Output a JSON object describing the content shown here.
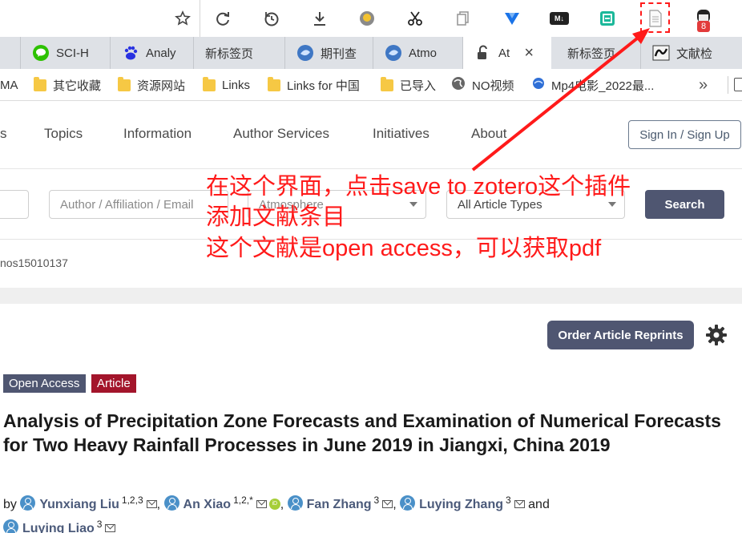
{
  "toolbar": {
    "icons": [
      "star-icon",
      "reload-icon",
      "history-icon",
      "download-icon",
      "extension-icon",
      "scissors-icon",
      "copy-icon",
      "extension-icon",
      "markdown-icon",
      "qr-icon",
      "zotero-save-icon",
      "profile-icon"
    ],
    "markdown_label": "M↓",
    "badge_count": "8"
  },
  "tabs": [
    {
      "label": "SCI-H",
      "icon": "wechat-icon"
    },
    {
      "label": "Analy",
      "icon": "baidu-icon"
    },
    {
      "label": "新标签页",
      "icon": ""
    },
    {
      "label": "期刊查",
      "icon": "journal-icon"
    },
    {
      "label": "Atmo",
      "icon": "journal-icon"
    },
    {
      "label": "At",
      "icon": "unlock-icon",
      "close": "×"
    },
    {
      "label": "新标签页",
      "icon": ""
    },
    {
      "label": "文献检",
      "icon": "literature-icon"
    }
  ],
  "bookmarks": [
    {
      "label": "MA"
    },
    {
      "label": "其它收藏"
    },
    {
      "label": "资源网站"
    },
    {
      "label": "Links"
    },
    {
      "label": "Links for 中国"
    },
    {
      "label": "已导入"
    },
    {
      "label": "NO视频"
    },
    {
      "label": "Mp4电影_2022最..."
    }
  ],
  "bookmarks_overflow": "»",
  "nav": {
    "items": [
      "s",
      "Topics",
      "Information",
      "Author Services",
      "Initiatives",
      "About"
    ],
    "signin": "Sign In / Sign Up"
  },
  "search": {
    "author_placeholder": "Author / Affiliation / Email",
    "journal_value": "Atmosphere",
    "article_types": "All Article Types",
    "button": "Search"
  },
  "doi_fragment": "nos15010137",
  "article": {
    "reprints_button": "Order Article Reprints",
    "badge_open": "Open Access",
    "badge_type": "Article",
    "title": "Analysis of Precipitation Zone Forecasts and Examination of Numerical Forecasts for Two Heavy Rainfall Processes in June 2019 in Jiangxi, China 2019",
    "by": "by",
    "and": "and",
    "authors": [
      {
        "name": "Yunxiang Liu",
        "sup": "1,2,3"
      },
      {
        "name": "An Xiao",
        "sup": "1,2,*"
      },
      {
        "name": "Fan Zhang",
        "sup": "3"
      },
      {
        "name": "Luying Zhang",
        "sup": "3"
      },
      {
        "name": "Luying Liao",
        "sup": "3"
      }
    ]
  },
  "annotation": {
    "line1": "在这个界面，点击save to zotero这个插件",
    "line2": "添加文献条目",
    "line3": "这个文献是open access，可以获取pdf",
    "color": "#ff1a1a"
  }
}
